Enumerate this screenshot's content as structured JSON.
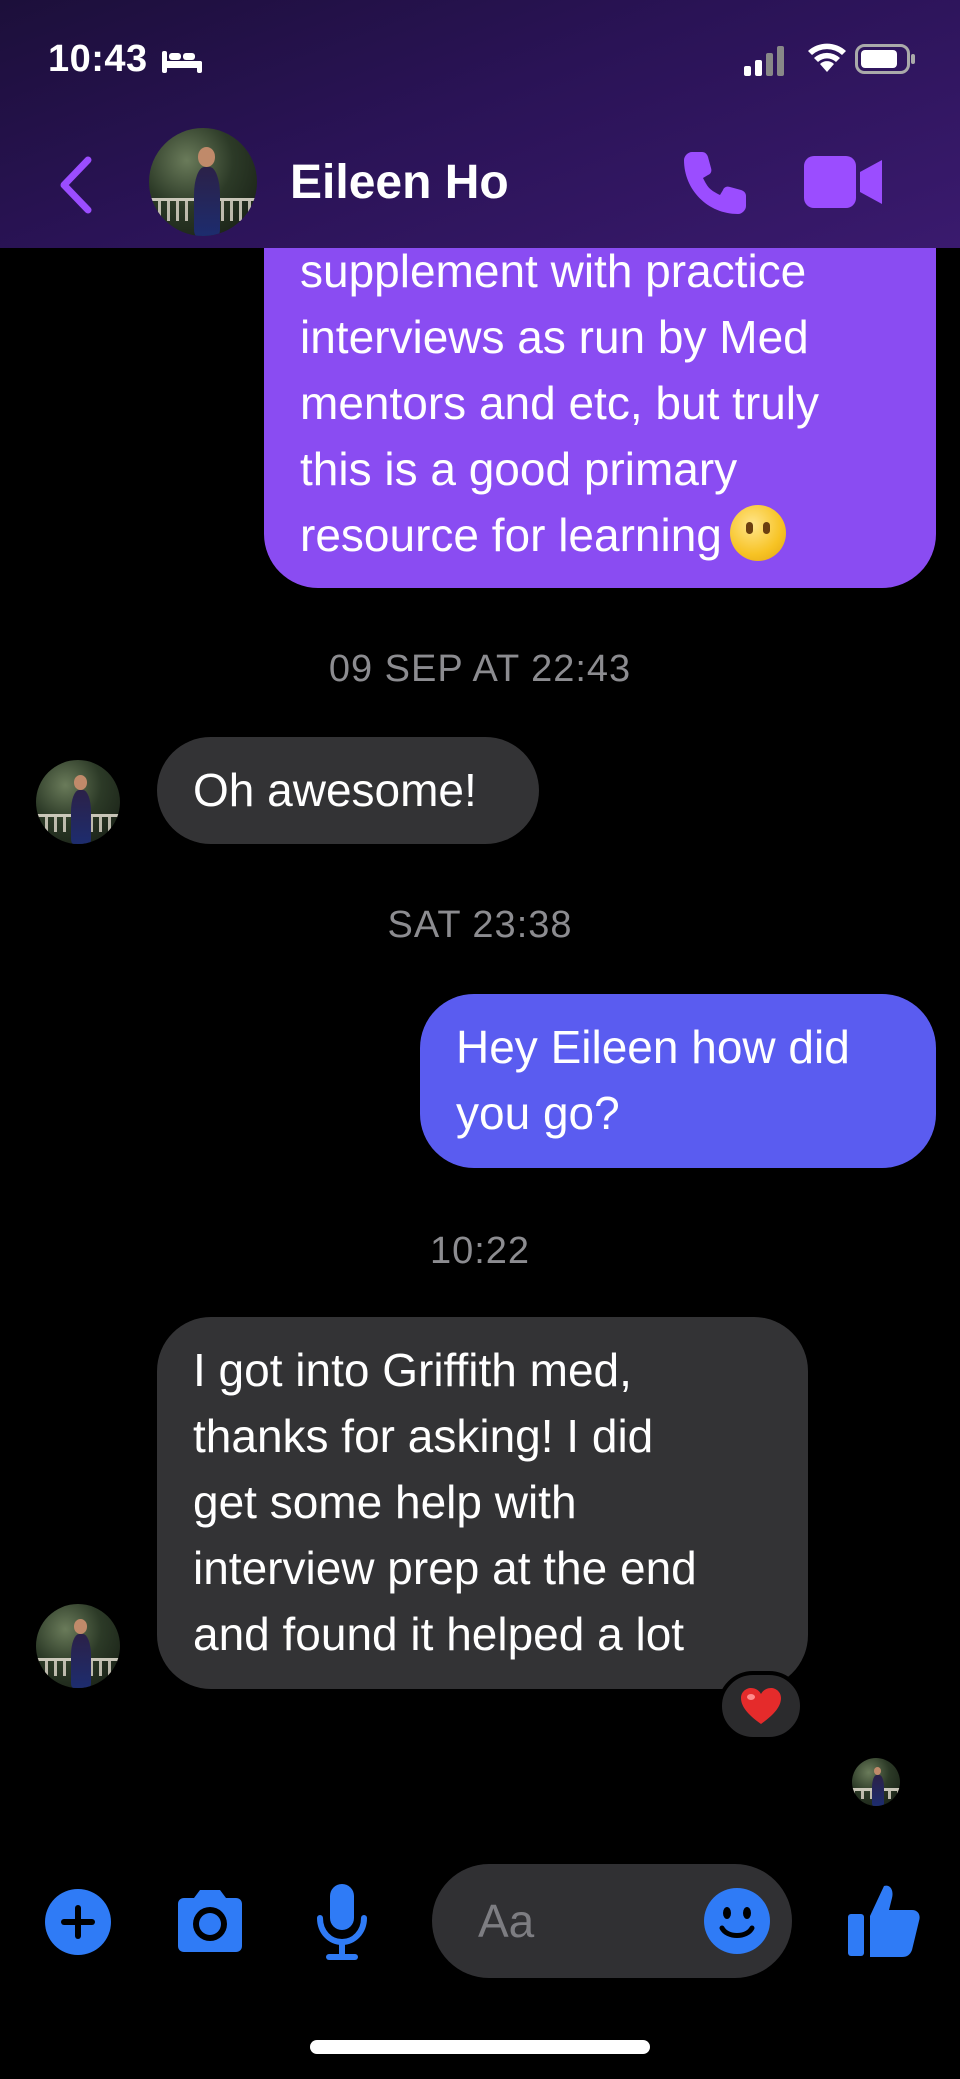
{
  "status_bar": {
    "time": "10:43",
    "icons": [
      "bed-icon",
      "signal-icon",
      "wifi-icon",
      "battery-icon"
    ]
  },
  "header": {
    "back_icon": "chevron-left-icon",
    "contact_name": "Eileen Ho",
    "call_icon": "phone-icon",
    "video_icon": "video-camera-icon",
    "accent_color": "#9b4dff"
  },
  "conversation": {
    "messages": [
      {
        "direction": "outgoing",
        "text": "supplement with practice\ninterviews as run by Med\nmentors and etc, but truly\nthis is a good primary\nresource for learning",
        "emoji": "slightly-smiling-face"
      },
      {
        "type": "timestamp",
        "text": "09 SEP AT 22:43"
      },
      {
        "direction": "incoming",
        "text": "Oh awesome!"
      },
      {
        "type": "timestamp",
        "text": "SAT 23:38"
      },
      {
        "direction": "outgoing",
        "text": "Hey Eileen how did\nyou go?"
      },
      {
        "type": "timestamp",
        "text": "10:22"
      },
      {
        "direction": "incoming",
        "text": "I got into Griffith med,\nthanks for asking! I did\nget some help with\ninterview prep at the end\nand found it helped a lot",
        "reaction": "heart-icon"
      }
    ],
    "bubble_colors": {
      "outgoing_top": "#8a4cf2",
      "outgoing_bottom": "#5a5cf0",
      "incoming": "#333335"
    }
  },
  "composer": {
    "placeholder": "Aa",
    "icons": [
      "plus-icon",
      "camera-icon",
      "microphone-icon",
      "emoji-icon",
      "thumbs-up-icon"
    ],
    "accent_color": "#2f7bf6"
  }
}
